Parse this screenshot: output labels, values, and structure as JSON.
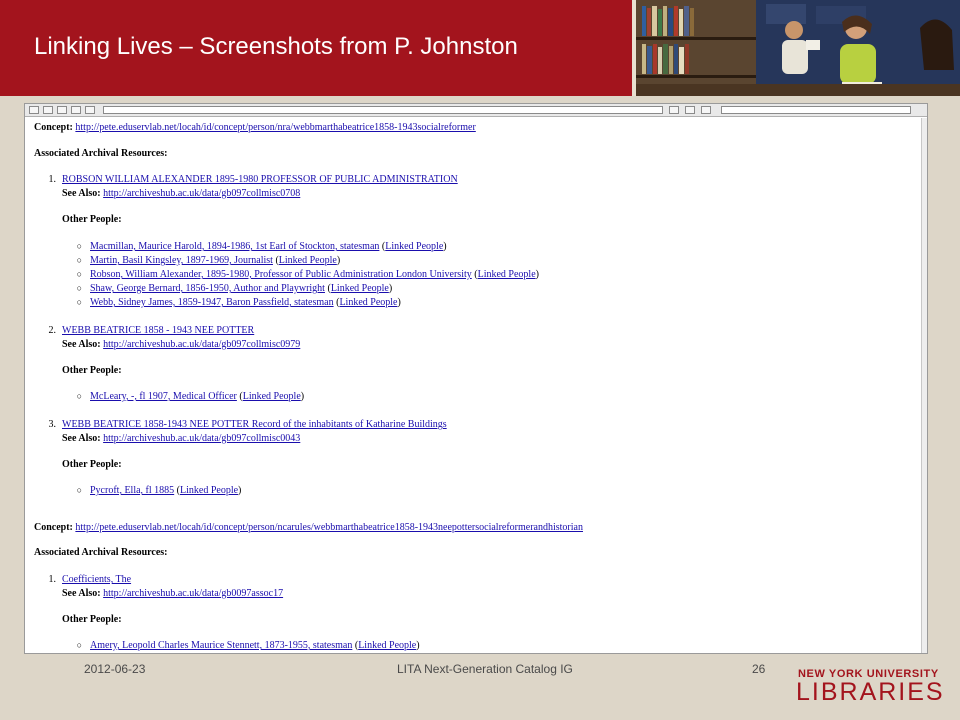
{
  "slide": {
    "title": "Linking Lives – Screenshots from P. Johnston",
    "footer": {
      "date": "2012-06-23",
      "center": "LITA Next-Generation Catalog IG",
      "page": "26",
      "logo_line1": "NEW YORK UNIVERSITY",
      "logo_line2": "LIBRARIES"
    },
    "accent_color": "#a3141d"
  },
  "browser": {
    "labels": {
      "concept": "Concept:",
      "associated": "Associated Archival Resources:",
      "see_also": "See Also:",
      "other_people": "Other People:",
      "linked_people": "Linked People",
      "open_paren": "(",
      "close_paren": ")"
    },
    "concept1": {
      "url": "http://pete.eduservlab.net/locah/id/concept/person/nra/webbmarthabeatrice1858-1943socialreformer",
      "resources": [
        {
          "num": "1.",
          "title": "ROBSON WILLIAM ALEXANDER 1895-1980 PROFESSOR OF PUBLIC ADMINISTRATION",
          "see_also": "http://archiveshub.ac.uk/data/gb097collmisc0708",
          "people": [
            "Macmillan, Maurice Harold, 1894-1986, 1st Earl of Stockton, statesman",
            "Martin, Basil Kingsley, 1897-1969, Journalist",
            "Robson, William Alexander, 1895-1980, Professor of Public Administration London University",
            "Shaw, George Bernard, 1856-1950, Author and Playwright",
            "Webb, Sidney James, 1859-1947, Baron Passfield, statesman"
          ]
        },
        {
          "num": "2.",
          "title": "WEBB BEATRICE 1858 - 1943 NEE POTTER",
          "see_also": "http://archiveshub.ac.uk/data/gb097collmisc0979",
          "people": [
            "McLeary, -, fl 1907, Medical Officer"
          ]
        },
        {
          "num": "3.",
          "title": "WEBB BEATRICE 1858-1943 NEE POTTER Record of the inhabitants of Katharine Buildings",
          "see_also": "http://archiveshub.ac.uk/data/gb097collmisc0043",
          "people": [
            "Pycroft, Ella, fl 1885"
          ]
        }
      ]
    },
    "concept2": {
      "url": "http://pete.eduservlab.net/locah/id/concept/person/ncarules/webbmarthabeatrice1858-1943neepottersocialreformerandhistorian",
      "resources": [
        {
          "num": "1.",
          "title": "Coefficients, The",
          "see_also": "http://archiveshub.ac.uk/data/gb0097assoc17",
          "people": [
            "Amery, Leopold Charles Maurice Stennett, 1873-1955, statesman"
          ]
        }
      ]
    }
  }
}
